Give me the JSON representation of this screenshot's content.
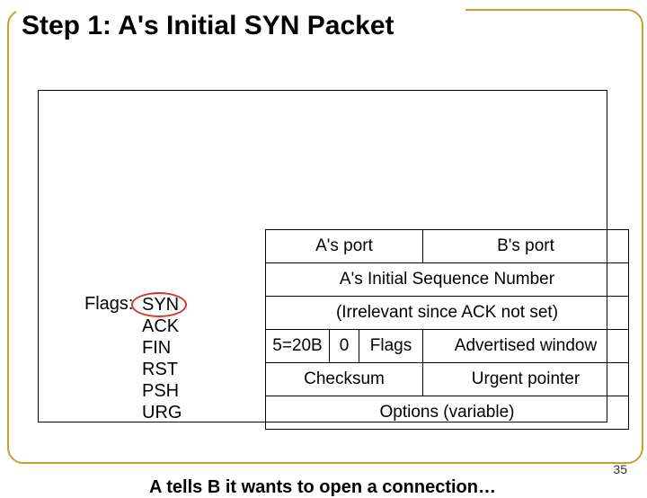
{
  "title": "Step 1: A's Initial SYN Packet",
  "flags": {
    "label": "Flags:",
    "items": [
      "SYN",
      "ACK",
      "FIN",
      "RST",
      "PSH",
      "URG"
    ]
  },
  "packet": {
    "row1": {
      "src_port": "A's port",
      "dst_port": "B's port"
    },
    "row2": {
      "seq": "A's Initial Sequence Number"
    },
    "row3": {
      "ack": "(Irrelevant since ACK not set)"
    },
    "row4": {
      "hdr_len": "5=20B",
      "zero": "0",
      "flags": "Flags",
      "adv_window": "Advertised window"
    },
    "row5": {
      "checksum": "Checksum",
      "urgent": "Urgent pointer"
    },
    "row6": {
      "options": "Options (variable)"
    }
  },
  "caption": "A tells B it wants to open a connection…",
  "page_number": "35"
}
